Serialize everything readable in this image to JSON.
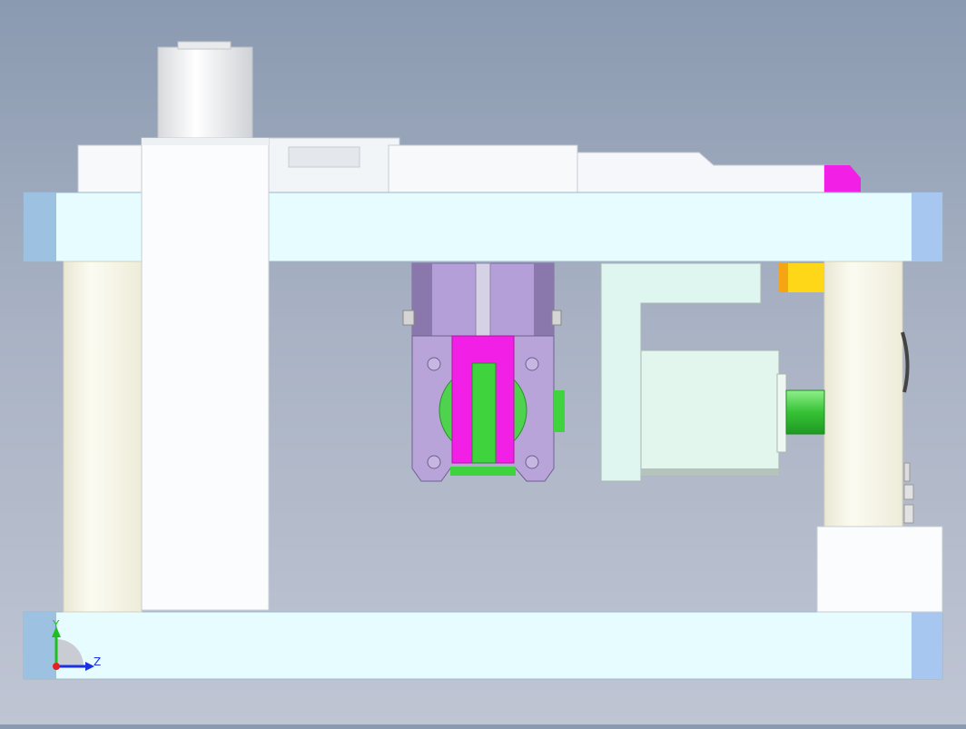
{
  "viewport": {
    "background_top": "#8a9ab0",
    "background_bottom": "#bfc5d3"
  },
  "model": {
    "colors": {
      "plate": "#e6fcff",
      "plate_end": "#a7c6ea",
      "column": "#f6f7ea",
      "upper_parts": "#f7f9fb",
      "gripper_body": "#b8a4d8",
      "gripper_block": "#a58fca",
      "jaw": "#f21fe6",
      "jaw_inner": "#3fd33d",
      "bracket": "#dff5ef",
      "motor": "#e3f6ee",
      "coupling": "#39c53a",
      "sensor_orange": "#f5a413",
      "sensor_yellow": "#ffd719",
      "magenta_tab": "#f21fe6"
    }
  },
  "triad": {
    "x_label": "",
    "y_label": "Y",
    "z_label": "Z",
    "y_color": "#1fbf1f",
    "z_color": "#1a2fe6",
    "x_color": "#e62020"
  }
}
